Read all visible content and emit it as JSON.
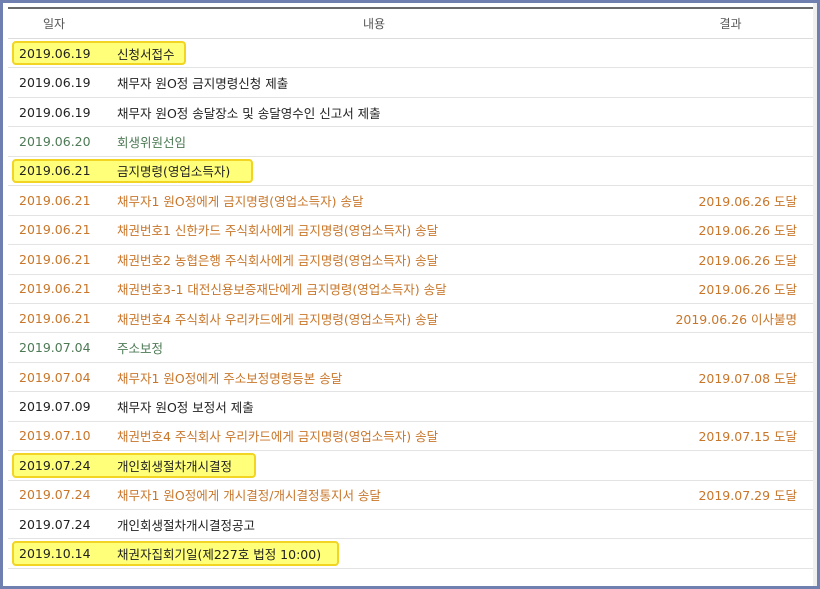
{
  "header": {
    "date": "일자",
    "content": "내용",
    "result": "결과"
  },
  "colors": {
    "black": "#222222",
    "orange": "#c8762a",
    "green": "#4d7a55",
    "highlight_fill": "#ffff7a",
    "highlight_border": "#f2d422",
    "frame": "#6f7fb0"
  },
  "rows": [
    {
      "date": "2019.06.19",
      "desc": "신청서접수",
      "result": "",
      "color": "#222222",
      "highlight": true,
      "hl_width": 170
    },
    {
      "date": "2019.06.19",
      "desc": "채무자 원O정 금지명령신청 제출",
      "result": "",
      "color": "#222222",
      "highlight": false
    },
    {
      "date": "2019.06.19",
      "desc": "채무자 원O정 송달장소 및 송달영수인 신고서 제출",
      "result": "",
      "color": "#222222",
      "highlight": false
    },
    {
      "date": "2019.06.20",
      "desc": "회생위원선임",
      "result": "",
      "color": "#4d7a55",
      "highlight": false
    },
    {
      "date": "2019.06.21",
      "desc": "금지명령(영업소득자)",
      "result": "",
      "color": "#222222",
      "highlight": true,
      "hl_width": 237
    },
    {
      "date": "2019.06.21",
      "desc": "채무자1 원O정에게 금지명령(영업소득자) 송달",
      "result": "2019.06.26 도달",
      "color": "#c8762a",
      "highlight": false
    },
    {
      "date": "2019.06.21",
      "desc": "채권번호1 신한카드 주식회사에게 금지명령(영업소득자) 송달",
      "result": "2019.06.26 도달",
      "color": "#c8762a",
      "highlight": false
    },
    {
      "date": "2019.06.21",
      "desc": "채권번호2 농협은행 주식회사에게 금지명령(영업소득자) 송달",
      "result": "2019.06.26 도달",
      "color": "#c8762a",
      "highlight": false
    },
    {
      "date": "2019.06.21",
      "desc": "채권번호3-1 대전신용보증재단에게 금지명령(영업소득자) 송달",
      "result": "2019.06.26 도달",
      "color": "#c8762a",
      "highlight": false
    },
    {
      "date": "2019.06.21",
      "desc": "채권번호4 주식회사 우리카드에게 금지명령(영업소득자) 송달",
      "result": "2019.06.26 이사불명",
      "color": "#c8762a",
      "highlight": false
    },
    {
      "date": "2019.07.04",
      "desc": "주소보정",
      "result": "",
      "color": "#4d7a55",
      "highlight": false
    },
    {
      "date": "2019.07.04",
      "desc": "채무자1 원O정에게 주소보정명령등본 송달",
      "result": "2019.07.08 도달",
      "color": "#c8762a",
      "highlight": false
    },
    {
      "date": "2019.07.09",
      "desc": "채무자 원O정 보정서 제출",
      "result": "",
      "color": "#222222",
      "highlight": false
    },
    {
      "date": "2019.07.10",
      "desc": "채권번호4 주식회사 우리카드에게 금지명령(영업소득자) 송달",
      "result": "2019.07.15 도달",
      "color": "#c8762a",
      "highlight": false
    },
    {
      "date": "2019.07.24",
      "desc": "개인회생절차개시결정",
      "result": "",
      "color": "#222222",
      "highlight": true,
      "hl_width": 240
    },
    {
      "date": "2019.07.24",
      "desc": "채무자1 원O정에게 개시결정/개시결정통지서 송달",
      "result": "2019.07.29 도달",
      "color": "#c8762a",
      "highlight": false
    },
    {
      "date": "2019.07.24",
      "desc": "개인회생절차개시결정공고",
      "result": "",
      "color": "#222222",
      "highlight": false
    },
    {
      "date": "2019.10.14",
      "desc": "채권자집회기일(제227호 법정 10:00)",
      "result": "",
      "color": "#222222",
      "highlight": true,
      "hl_width": 323
    }
  ]
}
